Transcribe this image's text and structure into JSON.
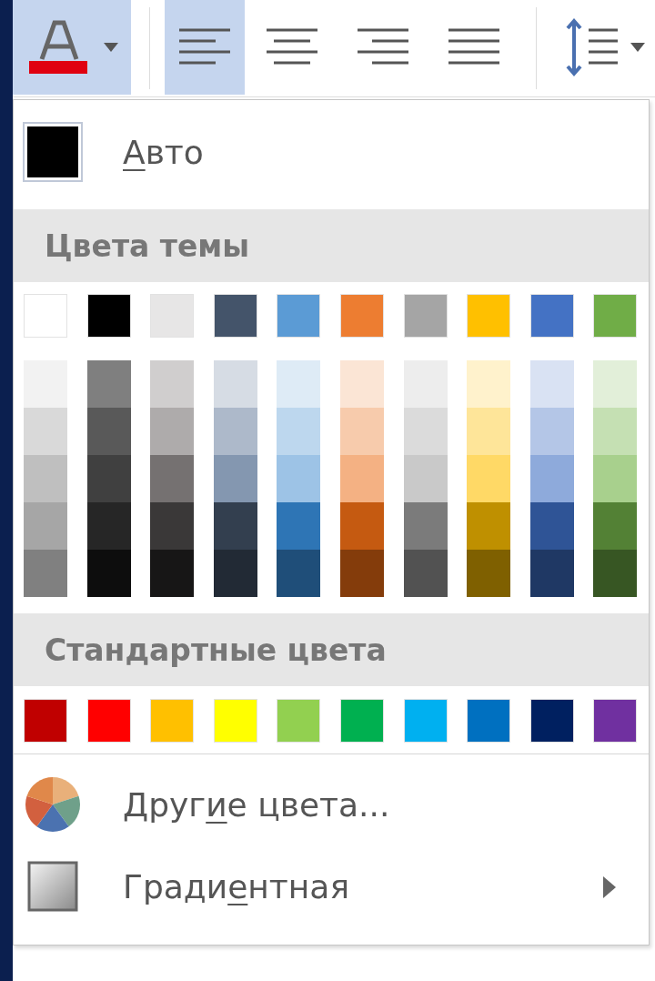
{
  "toolbar": {
    "buttons": [
      {
        "kind": "font-color",
        "selected": true
      },
      {
        "kind": "align-left",
        "selected": true
      },
      {
        "kind": "align-center",
        "selected": false
      },
      {
        "kind": "align-right",
        "selected": false
      },
      {
        "kind": "justify",
        "selected": false
      },
      {
        "kind": "line-spacing",
        "selected": false
      }
    ]
  },
  "menu": {
    "auto": {
      "label": {
        "key": "А",
        "after": "вто"
      }
    },
    "theme_colors": {
      "title": "Цвета темы",
      "base": [
        {
          "color": "#ffffff"
        },
        {
          "color": "#000000"
        },
        {
          "color": "#e7e6e6"
        },
        {
          "color": "#44546a"
        },
        {
          "color": "#5b9bd5"
        },
        {
          "color": "#ed7d31"
        },
        {
          "color": "#a5a5a5"
        },
        {
          "color": "#ffc000"
        },
        {
          "color": "#4472c4"
        },
        {
          "color": "#70ad47"
        }
      ],
      "shades": [
        [
          {
            "color": "#f2f2f2"
          },
          {
            "color": "#d9d9d9"
          },
          {
            "color": "#bfbfbf"
          },
          {
            "color": "#a6a6a6"
          },
          {
            "color": "#808080"
          }
        ],
        [
          {
            "color": "#7f7f7f"
          },
          {
            "color": "#595959"
          },
          {
            "color": "#404040"
          },
          {
            "color": "#262626"
          },
          {
            "color": "#0d0d0d"
          }
        ],
        [
          {
            "color": "#d0cece"
          },
          {
            "color": "#aeabab"
          },
          {
            "color": "#757171"
          },
          {
            "color": "#3a3838"
          },
          {
            "color": "#171616"
          }
        ],
        [
          {
            "color": "#d6dce4"
          },
          {
            "color": "#adb9ca"
          },
          {
            "color": "#8497b0"
          },
          {
            "color": "#333f4f"
          },
          {
            "color": "#222a35"
          }
        ],
        [
          {
            "color": "#deebf6"
          },
          {
            "color": "#bdd7ee"
          },
          {
            "color": "#9dc3e6"
          },
          {
            "color": "#2e75b5"
          },
          {
            "color": "#1f4e79"
          }
        ],
        [
          {
            "color": "#fbe5d5"
          },
          {
            "color": "#f7cbac"
          },
          {
            "color": "#f4b183"
          },
          {
            "color": "#c55a11"
          },
          {
            "color": "#843c0b"
          }
        ],
        [
          {
            "color": "#ededed"
          },
          {
            "color": "#dbdbdb"
          },
          {
            "color": "#c9c9c9"
          },
          {
            "color": "#7b7b7b"
          },
          {
            "color": "#525252"
          }
        ],
        [
          {
            "color": "#fff2cc"
          },
          {
            "color": "#fee599"
          },
          {
            "color": "#ffd966"
          },
          {
            "color": "#bf9000"
          },
          {
            "color": "#7f6000"
          }
        ],
        [
          {
            "color": "#d9e2f3"
          },
          {
            "color": "#b4c6e7"
          },
          {
            "color": "#8eaadb"
          },
          {
            "color": "#2f5496"
          },
          {
            "color": "#1f3864"
          }
        ],
        [
          {
            "color": "#e2efd9"
          },
          {
            "color": "#c5e0b3"
          },
          {
            "color": "#a8d08d"
          },
          {
            "color": "#538135"
          },
          {
            "color": "#375623"
          }
        ]
      ]
    },
    "standard_colors": {
      "title": "Стандартные цвета",
      "colors": [
        {
          "color": "#c00000"
        },
        {
          "color": "#ff0000"
        },
        {
          "color": "#ffc000"
        },
        {
          "color": "#ffff00"
        },
        {
          "color": "#92d050"
        },
        {
          "color": "#00b050"
        },
        {
          "color": "#00b0f0"
        },
        {
          "color": "#0070c0"
        },
        {
          "color": "#002060"
        },
        {
          "color": "#7030a0"
        }
      ]
    },
    "items": [
      {
        "kind": "more-colors",
        "label": {
          "before": "Друг",
          "key": "и",
          "after": "е цвета..."
        }
      },
      {
        "kind": "gradient",
        "label": {
          "before": "Гради",
          "key": "е",
          "after": "нтная"
        }
      }
    ]
  }
}
